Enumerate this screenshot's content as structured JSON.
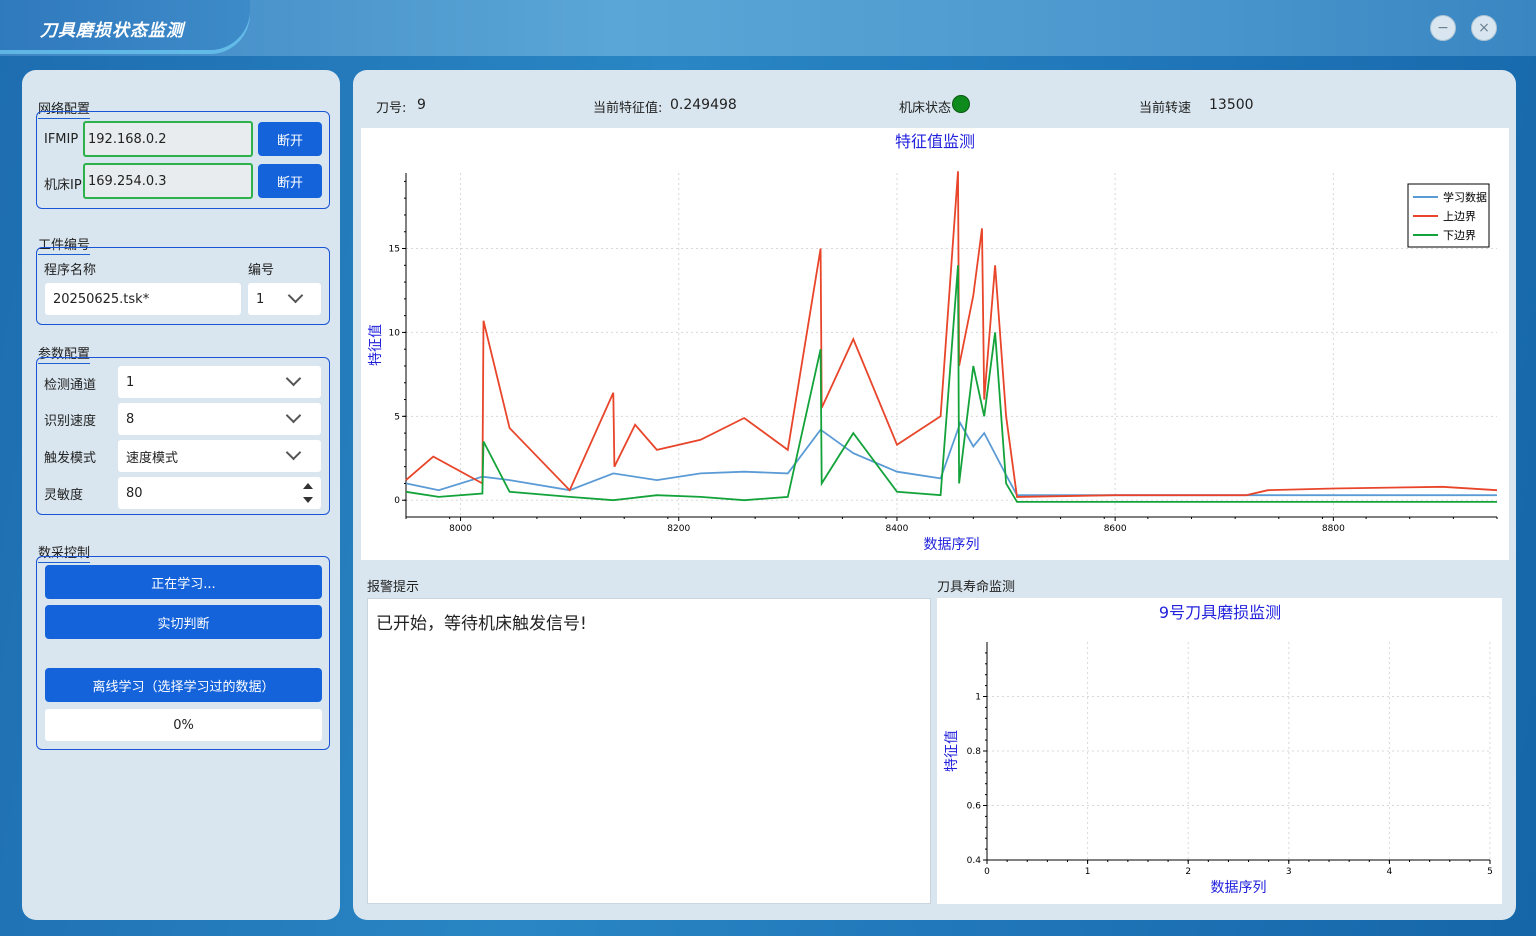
{
  "window": {
    "title": "刀具磨损状态监测",
    "minimize_icon": "minus-icon",
    "close_icon": "close-icon"
  },
  "network": {
    "group_title": "网络配置",
    "ifmip_label": "IFMIP",
    "ifmip_value": "192.168.0.2",
    "ifmip_button": "断开",
    "machine_ip_label": "机床IP",
    "machine_ip_value": "169.254.0.3",
    "machine_ip_button": "断开"
  },
  "workpiece": {
    "group_title": "工件编号",
    "program_label": "程序名称",
    "program_value": "20250625.tsk*",
    "number_label": "编号",
    "number_value": "1"
  },
  "params": {
    "group_title": "参数配置",
    "channel_label": "检测通道",
    "channel_value": "1",
    "speed_label": "识别速度",
    "speed_value": "8",
    "trigger_label": "触发模式",
    "trigger_value": "速度模式",
    "sensitivity_label": "灵敏度",
    "sensitivity_value": "80"
  },
  "acquisition": {
    "group_title": "数采控制",
    "learning_button": "正在学习...",
    "judge_button": "实切判断",
    "offline_button": "离线学习（选择学习过的数据）",
    "progress_text": "0%",
    "progress": 0
  },
  "status_bar": {
    "tool_label": "刀号:",
    "tool_value": "9",
    "feature_label": "当前特征值:",
    "feature_value": "0.249498",
    "machine_label": "机床状态",
    "machine_color": "#0f8a1c",
    "speed_label": "当前转速",
    "speed_value": "13500"
  },
  "alarm": {
    "section_title": "报警提示",
    "message": "已开始，等待机床触发信号!"
  },
  "life": {
    "section_title": "刀具寿命监测"
  },
  "chart_data": [
    {
      "type": "line",
      "title": "特征值监测",
      "xlabel": "数据序列",
      "ylabel": "特征值",
      "xlim": [
        7950,
        8950
      ],
      "ylim": [
        -1,
        19.5
      ],
      "xticks": [
        8000,
        8200,
        8400,
        8600,
        8800
      ],
      "yticks": [
        0,
        5,
        10,
        15
      ],
      "grid": true,
      "legend": "top-right",
      "colors": [
        "#5b9bd5",
        "#e8452a",
        "#13a33a"
      ],
      "series": [
        {
          "name": "学习数据",
          "x": [
            7950,
            7980,
            8020,
            8045,
            8100,
            8140,
            8180,
            8220,
            8260,
            8300,
            8330,
            8360,
            8400,
            8440,
            8458,
            8470,
            8480,
            8500,
            8510,
            8600,
            8700,
            8800,
            8900,
            8950
          ],
          "y": [
            1.0,
            0.6,
            1.4,
            1.2,
            0.6,
            1.6,
            1.2,
            1.6,
            1.7,
            1.6,
            4.2,
            2.8,
            1.7,
            1.3,
            4.6,
            3.2,
            4.0,
            1.5,
            0.3,
            0.3,
            0.3,
            0.3,
            0.3,
            0.3
          ]
        },
        {
          "name": "上边界",
          "x": [
            7950,
            7975,
            8020,
            8021,
            8045,
            8100,
            8140,
            8141,
            8160,
            8180,
            8220,
            8260,
            8300,
            8330,
            8331,
            8360,
            8400,
            8440,
            8456,
            8457,
            8470,
            8478,
            8480,
            8490,
            8500,
            8510,
            8600,
            8700,
            8720,
            8740,
            8800,
            8900,
            8950
          ],
          "y": [
            1.2,
            2.6,
            1.0,
            10.7,
            4.3,
            0.6,
            6.4,
            2.0,
            4.5,
            3.0,
            3.6,
            4.9,
            3.0,
            15.0,
            5.5,
            9.6,
            3.3,
            5.0,
            19.6,
            8.0,
            12.2,
            16.2,
            6.0,
            14.0,
            5.0,
            0.2,
            0.3,
            0.3,
            0.3,
            0.6,
            0.7,
            0.8,
            0.6
          ]
        },
        {
          "name": "下边界",
          "x": [
            7950,
            7980,
            8020,
            8021,
            8045,
            8100,
            8140,
            8180,
            8220,
            8260,
            8300,
            8330,
            8331,
            8360,
            8400,
            8440,
            8456,
            8457,
            8470,
            8480,
            8490,
            8500,
            8510,
            8600,
            8700,
            8800,
            8900,
            8950
          ],
          "y": [
            0.5,
            0.2,
            0.4,
            3.5,
            0.5,
            0.2,
            0.0,
            0.3,
            0.2,
            0.0,
            0.2,
            9.0,
            1.0,
            4.0,
            0.5,
            0.3,
            14.0,
            1.0,
            8.0,
            5.0,
            10.0,
            1.0,
            -0.1,
            -0.1,
            -0.1,
            -0.1,
            -0.1,
            -0.1
          ]
        }
      ]
    },
    {
      "type": "line",
      "title": "9号刀具磨损监测",
      "xlabel": "数据序列",
      "ylabel": "特征值",
      "xlim": [
        0,
        5
      ],
      "ylim": [
        0.4,
        1.2
      ],
      "xticks": [
        0,
        1,
        2,
        3,
        4,
        5
      ],
      "yticks": [
        0.4,
        0.6,
        0.8,
        1
      ],
      "grid": true,
      "series": []
    }
  ]
}
